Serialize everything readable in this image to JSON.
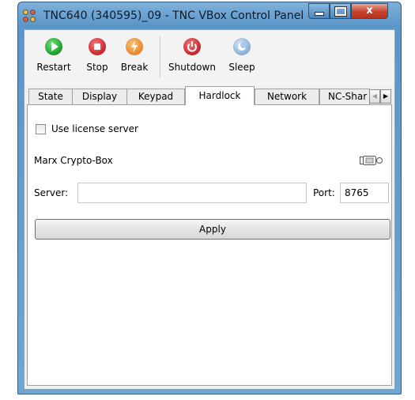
{
  "window": {
    "title": "TNC640 (340595)_09 - TNC VBox Control Panel",
    "controls": {
      "minimize": "minimize",
      "maximize": "maximize",
      "close": "x"
    }
  },
  "toolbar": {
    "restart": {
      "label": "Restart",
      "icon": "play-icon",
      "color": "#1c9a2a"
    },
    "stop": {
      "label": "Stop",
      "icon": "stop-icon",
      "color": "#c9252b"
    },
    "break": {
      "label": "Break",
      "icon": "lightning-icon",
      "color": "#e8842a"
    },
    "shutdown": {
      "label": "Shutdown",
      "icon": "power-icon",
      "color": "#c4242b"
    },
    "sleep": {
      "label": "Sleep",
      "icon": "moon-icon",
      "color": "#7fa9d4"
    }
  },
  "tabs": [
    {
      "label": "State"
    },
    {
      "label": "Display"
    },
    {
      "label": "Keypad"
    },
    {
      "label": "Hardlock",
      "active": true
    },
    {
      "label": "Network"
    },
    {
      "label": "NC-Shar"
    }
  ],
  "hardlock": {
    "use_license_server": {
      "label": "Use license server",
      "checked": false
    },
    "device_label": "Marx Crypto-Box",
    "server": {
      "label": "Server:",
      "value": ""
    },
    "port": {
      "label": "Port:",
      "value": "8765"
    },
    "apply_label": "Apply"
  }
}
